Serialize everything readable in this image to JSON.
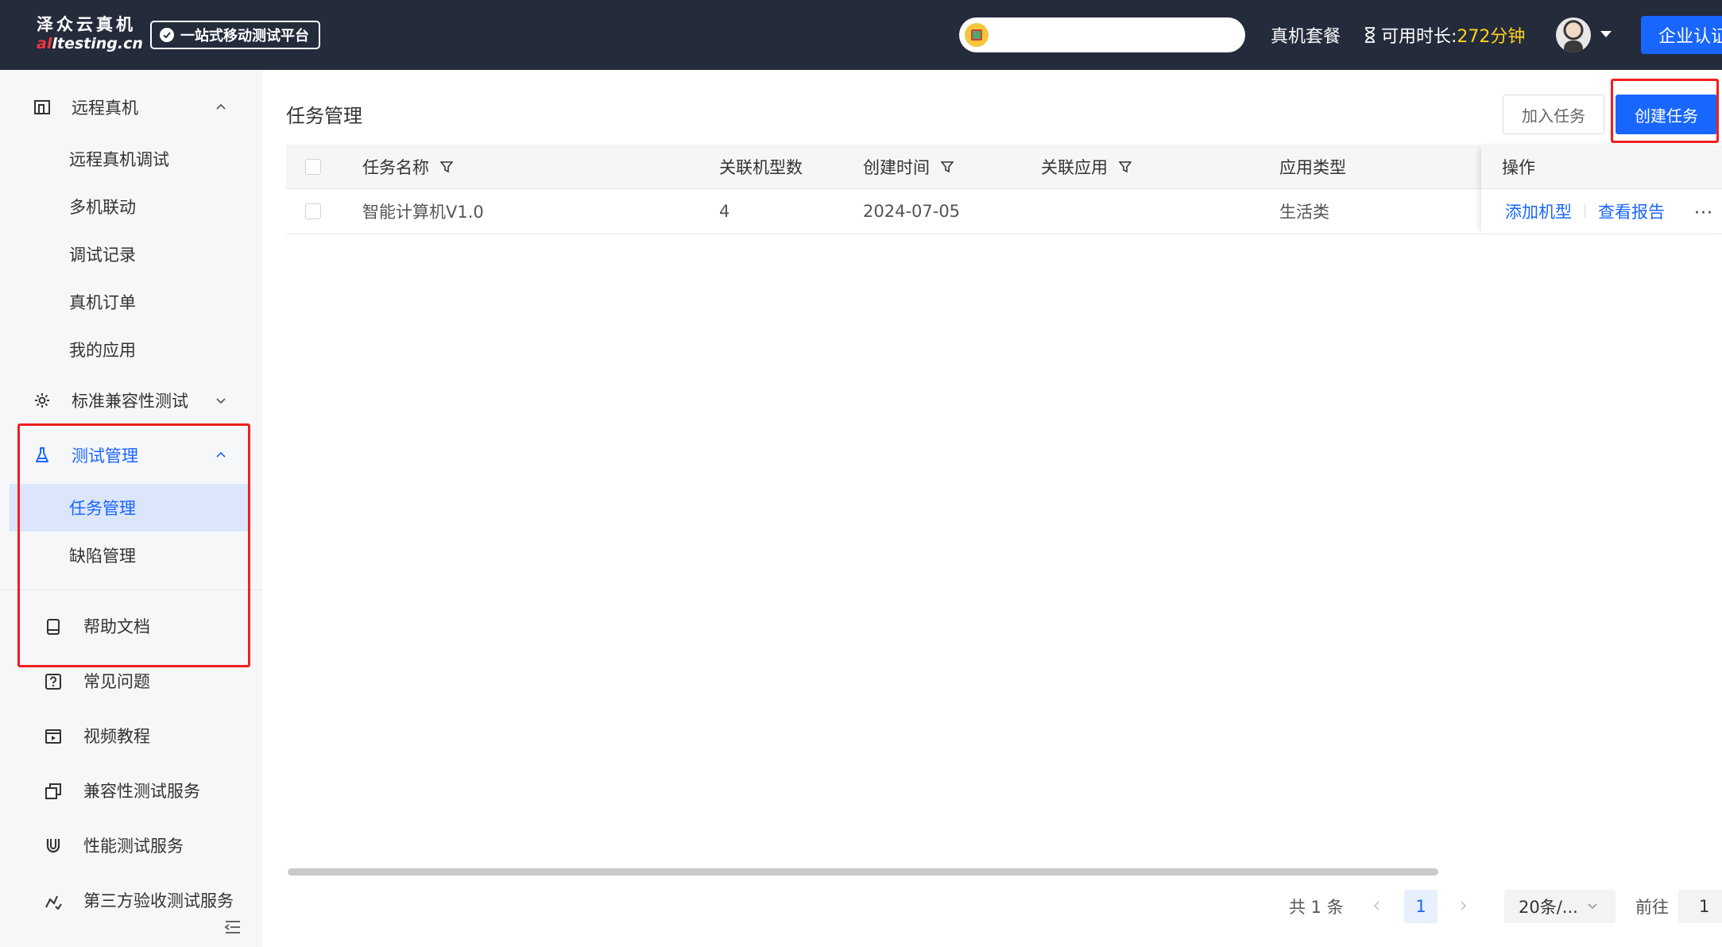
{
  "topbar": {
    "logo_cn": "泽众云真机",
    "logo_en_red": "al",
    "logo_en_rest": "ltesting.cn",
    "platform_badge": "一站式移动测试平台",
    "plan_label": "真机套餐",
    "timer_label": "可用时长:",
    "timer_value": "272分钟",
    "enterprise_label": "企业认证"
  },
  "sidebar": {
    "groups": [
      {
        "label": "远程真机",
        "items": [
          "远程真机调试",
          "多机联动",
          "调试记录",
          "真机订单",
          "我的应用"
        ]
      },
      {
        "label": "标准兼容性测试"
      },
      {
        "label": "测试管理",
        "items": [
          "任务管理",
          "缺陷管理"
        ]
      }
    ],
    "help": [
      "帮助文档",
      "常见问题",
      "视频教程",
      "兼容性测试服务",
      "性能测试服务",
      "第三方验收测试服务"
    ]
  },
  "main": {
    "title": "任务管理",
    "join_button": "加入任务",
    "create_button": "创建任务",
    "table": {
      "headers": [
        "任务名称",
        "关联机型数",
        "创建时间",
        "关联应用",
        "应用类型",
        "操作"
      ],
      "rows": [
        {
          "name": "智能计算机V1.0",
          "model_count": "4",
          "created": "2024-07-05",
          "app": "",
          "app_type": "生活类"
        }
      ],
      "actions": [
        "添加机型",
        "查看报告",
        "···"
      ]
    },
    "pagination": {
      "total": "共 1 条",
      "current_page": "1",
      "page_size": "20条/...",
      "goto_label": "前往",
      "goto_value": "1"
    }
  },
  "colors": {
    "primary": "#1966ff",
    "topbar": "#242b3b",
    "highlight_box": "#f11f1f",
    "timer": "#ffd21e"
  }
}
